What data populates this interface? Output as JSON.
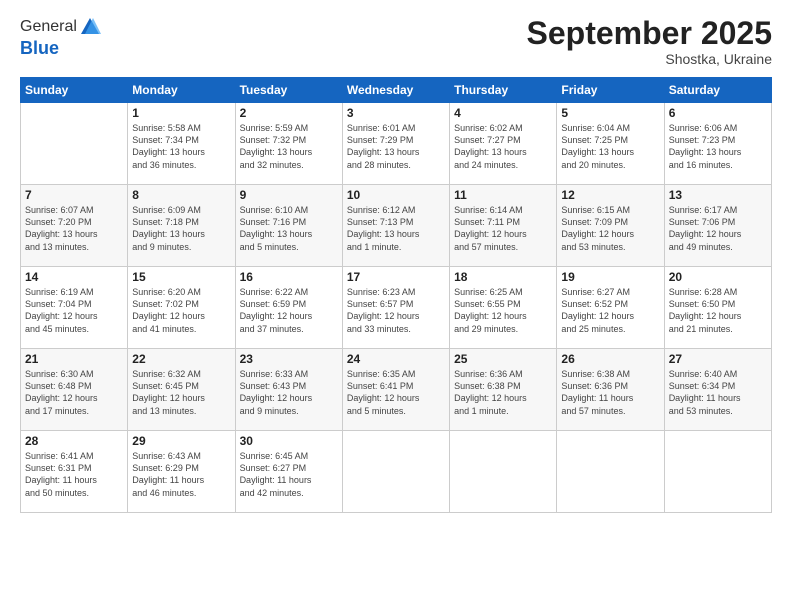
{
  "logo": {
    "general": "General",
    "blue": "Blue"
  },
  "title": "September 2025",
  "location": "Shostka, Ukraine",
  "days_header": [
    "Sunday",
    "Monday",
    "Tuesday",
    "Wednesday",
    "Thursday",
    "Friday",
    "Saturday"
  ],
  "weeks": [
    [
      {
        "day": "",
        "info": ""
      },
      {
        "day": "1",
        "info": "Sunrise: 5:58 AM\nSunset: 7:34 PM\nDaylight: 13 hours\nand 36 minutes."
      },
      {
        "day": "2",
        "info": "Sunrise: 5:59 AM\nSunset: 7:32 PM\nDaylight: 13 hours\nand 32 minutes."
      },
      {
        "day": "3",
        "info": "Sunrise: 6:01 AM\nSunset: 7:29 PM\nDaylight: 13 hours\nand 28 minutes."
      },
      {
        "day": "4",
        "info": "Sunrise: 6:02 AM\nSunset: 7:27 PM\nDaylight: 13 hours\nand 24 minutes."
      },
      {
        "day": "5",
        "info": "Sunrise: 6:04 AM\nSunset: 7:25 PM\nDaylight: 13 hours\nand 20 minutes."
      },
      {
        "day": "6",
        "info": "Sunrise: 6:06 AM\nSunset: 7:23 PM\nDaylight: 13 hours\nand 16 minutes."
      }
    ],
    [
      {
        "day": "7",
        "info": "Sunrise: 6:07 AM\nSunset: 7:20 PM\nDaylight: 13 hours\nand 13 minutes."
      },
      {
        "day": "8",
        "info": "Sunrise: 6:09 AM\nSunset: 7:18 PM\nDaylight: 13 hours\nand 9 minutes."
      },
      {
        "day": "9",
        "info": "Sunrise: 6:10 AM\nSunset: 7:16 PM\nDaylight: 13 hours\nand 5 minutes."
      },
      {
        "day": "10",
        "info": "Sunrise: 6:12 AM\nSunset: 7:13 PM\nDaylight: 13 hours\nand 1 minute."
      },
      {
        "day": "11",
        "info": "Sunrise: 6:14 AM\nSunset: 7:11 PM\nDaylight: 12 hours\nand 57 minutes."
      },
      {
        "day": "12",
        "info": "Sunrise: 6:15 AM\nSunset: 7:09 PM\nDaylight: 12 hours\nand 53 minutes."
      },
      {
        "day": "13",
        "info": "Sunrise: 6:17 AM\nSunset: 7:06 PM\nDaylight: 12 hours\nand 49 minutes."
      }
    ],
    [
      {
        "day": "14",
        "info": "Sunrise: 6:19 AM\nSunset: 7:04 PM\nDaylight: 12 hours\nand 45 minutes."
      },
      {
        "day": "15",
        "info": "Sunrise: 6:20 AM\nSunset: 7:02 PM\nDaylight: 12 hours\nand 41 minutes."
      },
      {
        "day": "16",
        "info": "Sunrise: 6:22 AM\nSunset: 6:59 PM\nDaylight: 12 hours\nand 37 minutes."
      },
      {
        "day": "17",
        "info": "Sunrise: 6:23 AM\nSunset: 6:57 PM\nDaylight: 12 hours\nand 33 minutes."
      },
      {
        "day": "18",
        "info": "Sunrise: 6:25 AM\nSunset: 6:55 PM\nDaylight: 12 hours\nand 29 minutes."
      },
      {
        "day": "19",
        "info": "Sunrise: 6:27 AM\nSunset: 6:52 PM\nDaylight: 12 hours\nand 25 minutes."
      },
      {
        "day": "20",
        "info": "Sunrise: 6:28 AM\nSunset: 6:50 PM\nDaylight: 12 hours\nand 21 minutes."
      }
    ],
    [
      {
        "day": "21",
        "info": "Sunrise: 6:30 AM\nSunset: 6:48 PM\nDaylight: 12 hours\nand 17 minutes."
      },
      {
        "day": "22",
        "info": "Sunrise: 6:32 AM\nSunset: 6:45 PM\nDaylight: 12 hours\nand 13 minutes."
      },
      {
        "day": "23",
        "info": "Sunrise: 6:33 AM\nSunset: 6:43 PM\nDaylight: 12 hours\nand 9 minutes."
      },
      {
        "day": "24",
        "info": "Sunrise: 6:35 AM\nSunset: 6:41 PM\nDaylight: 12 hours\nand 5 minutes."
      },
      {
        "day": "25",
        "info": "Sunrise: 6:36 AM\nSunset: 6:38 PM\nDaylight: 12 hours\nand 1 minute."
      },
      {
        "day": "26",
        "info": "Sunrise: 6:38 AM\nSunset: 6:36 PM\nDaylight: 11 hours\nand 57 minutes."
      },
      {
        "day": "27",
        "info": "Sunrise: 6:40 AM\nSunset: 6:34 PM\nDaylight: 11 hours\nand 53 minutes."
      }
    ],
    [
      {
        "day": "28",
        "info": "Sunrise: 6:41 AM\nSunset: 6:31 PM\nDaylight: 11 hours\nand 50 minutes."
      },
      {
        "day": "29",
        "info": "Sunrise: 6:43 AM\nSunset: 6:29 PM\nDaylight: 11 hours\nand 46 minutes."
      },
      {
        "day": "30",
        "info": "Sunrise: 6:45 AM\nSunset: 6:27 PM\nDaylight: 11 hours\nand 42 minutes."
      },
      {
        "day": "",
        "info": ""
      },
      {
        "day": "",
        "info": ""
      },
      {
        "day": "",
        "info": ""
      },
      {
        "day": "",
        "info": ""
      }
    ]
  ]
}
